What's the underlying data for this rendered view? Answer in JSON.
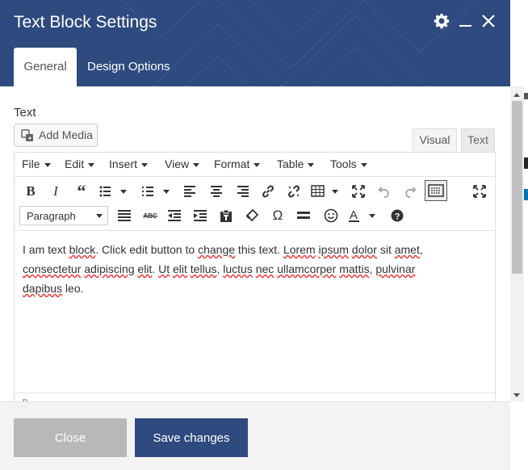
{
  "dialog": {
    "title": "Text Block Settings",
    "header_color": "#2e4a7f",
    "icons": [
      "gear-icon",
      "minimize-icon",
      "close-icon"
    ]
  },
  "tabs": [
    {
      "label": "General",
      "active": true
    },
    {
      "label": "Design Options",
      "active": false
    }
  ],
  "field": {
    "label": "Text",
    "add_media_label": "Add Media",
    "mode_tabs": [
      {
        "label": "Visual",
        "active": true
      },
      {
        "label": "Text",
        "active": false
      }
    ]
  },
  "editor": {
    "menu": [
      "File",
      "Edit",
      "Insert",
      "View",
      "Format",
      "Table",
      "Tools"
    ],
    "toolbar_row1_icons": [
      "bold-icon",
      "italic-icon",
      "blockquote-icon",
      "bullet-list-icon",
      "numbered-list-icon",
      "align-left-icon",
      "align-center-icon",
      "align-right-icon",
      "link-icon",
      "unlink-icon",
      "table-icon",
      "fullscreen-icon",
      "undo-icon",
      "redo-icon",
      "keyboard-toggle-icon",
      "expand-icon"
    ],
    "toolbar_row2_icons": [
      "justify-icon",
      "strikethrough-icon",
      "outdent-icon",
      "indent-icon",
      "paste-text-icon",
      "clear-format-icon",
      "special-char-icon",
      "horizontal-line-icon",
      "emoticon-icon",
      "text-color-icon",
      "help-icon"
    ],
    "format_select": "Paragraph",
    "content": {
      "line1_parts": [
        "I am text ",
        "block",
        ". Click edit button to ",
        "change",
        " this text. ",
        "Lorem",
        " ",
        "ipsum",
        " ",
        "dolor",
        " sit ",
        "amet",
        ","
      ],
      "line2_parts": [
        "consectetur",
        " ",
        "adipiscing",
        " ",
        "elit",
        ". ",
        "Ut",
        " ",
        "elit",
        " ",
        "tellus",
        ", ",
        "luctus",
        " ",
        "nec",
        " ",
        "ullamcorper",
        " ",
        "mattis",
        ", ",
        "pulvinar"
      ],
      "line3_parts": [
        "dapibus",
        " leo."
      ]
    },
    "status_path": "p"
  },
  "footer": {
    "close_label": "Close",
    "save_label": "Save changes",
    "close_color": "#b8b8b8",
    "save_color": "#2e4a7f"
  }
}
